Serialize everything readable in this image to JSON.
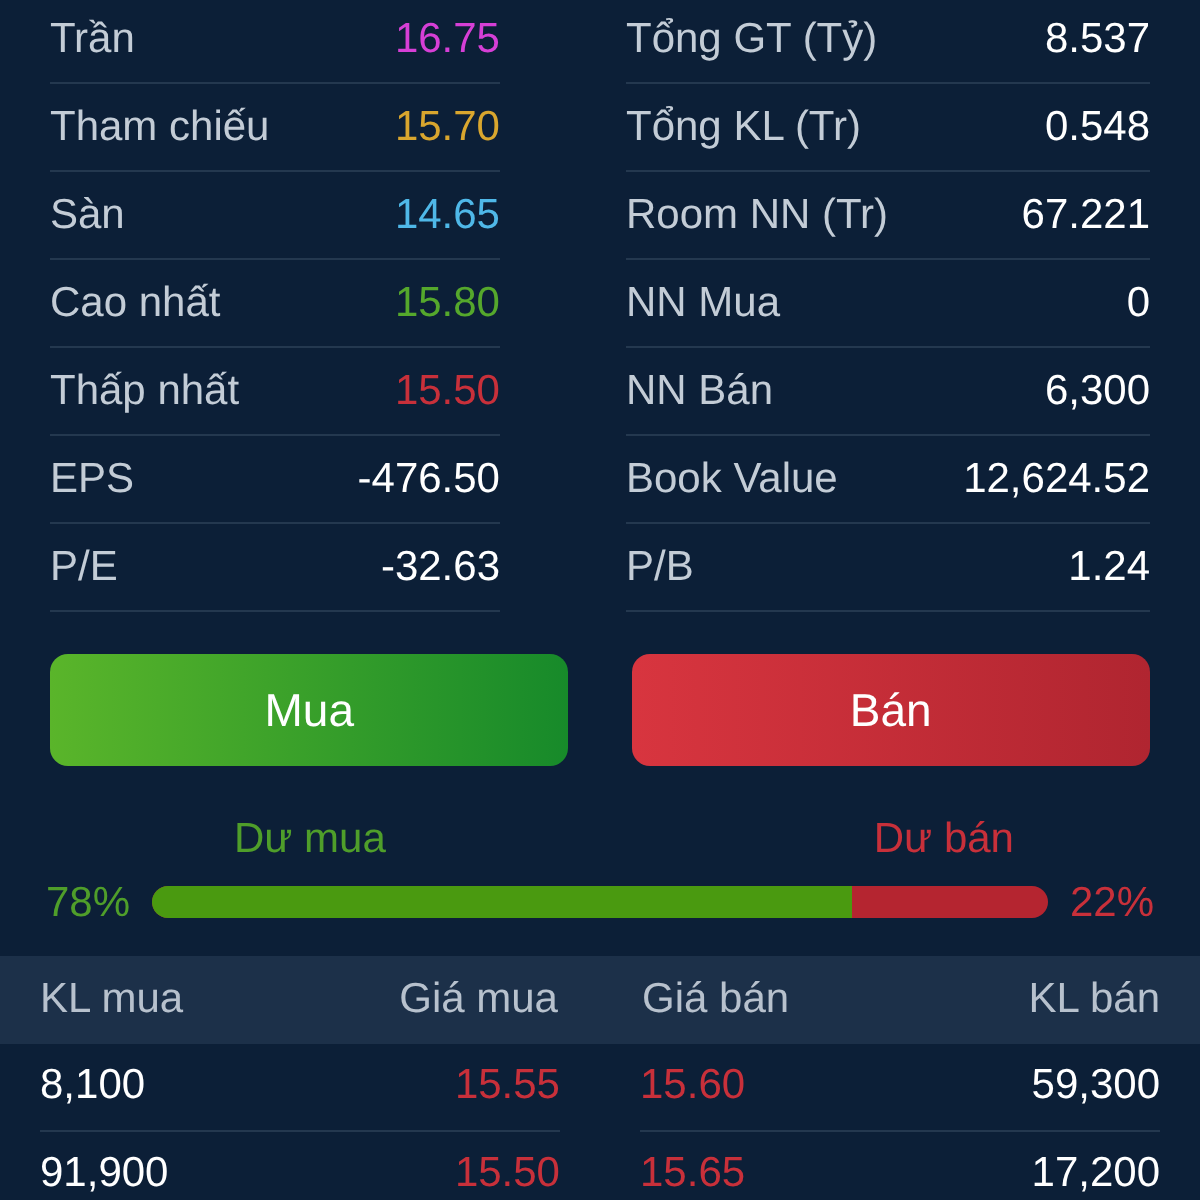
{
  "stats_left": [
    {
      "label": "Trần",
      "value": "16.75",
      "color": "#d63fd6"
    },
    {
      "label": "Tham chiếu",
      "value": "15.70",
      "color": "#d9a62e"
    },
    {
      "label": "Sàn",
      "value": "14.65",
      "color": "#4fb8e8"
    },
    {
      "label": "Cao nhất",
      "value": "15.80",
      "color": "#55a82c"
    },
    {
      "label": "Thấp nhất",
      "value": "15.50",
      "color": "#c8303a"
    },
    {
      "label": "EPS",
      "value": "-476.50",
      "color": "#ffffff"
    },
    {
      "label": "P/E",
      "value": "-32.63",
      "color": "#ffffff"
    }
  ],
  "stats_right": [
    {
      "label": "Tổng GT (Tỷ)",
      "value": "8.537"
    },
    {
      "label": "Tổng KL (Tr)",
      "value": "0.548"
    },
    {
      "label": "Room NN (Tr)",
      "value": "67.221"
    },
    {
      "label": "NN Mua",
      "value": "0"
    },
    {
      "label": "NN Bán",
      "value": "6,300"
    },
    {
      "label": "Book Value",
      "value": "12,624.52"
    },
    {
      "label": "P/B",
      "value": "1.24"
    }
  ],
  "buttons": [
    {
      "label": "Mua",
      "kind": "buy"
    },
    {
      "label": "Bán",
      "kind": "sell"
    }
  ],
  "balance": {
    "buy_label": "Dư mua",
    "sell_label": "Dư bán",
    "buy_percent": "78%",
    "sell_percent": "22%",
    "level": 0.78
  },
  "order_book": {
    "columns": [
      "KL mua",
      "Giá mua",
      "Giá bán",
      "KL bán"
    ],
    "rows": [
      {
        "buy_volume": "8,100",
        "buy_price": {
          "text": "15.55",
          "color": "#c8303a"
        },
        "sell_price": {
          "text": "15.60",
          "color": "#c8303a"
        },
        "sell_volume": "59,300"
      },
      {
        "buy_volume": "91,900",
        "buy_price": {
          "text": "15.50",
          "color": "#c8303a"
        },
        "sell_price": {
          "text": "15.65",
          "color": "#c8303a"
        },
        "sell_volume": "17,200"
      }
    ]
  }
}
